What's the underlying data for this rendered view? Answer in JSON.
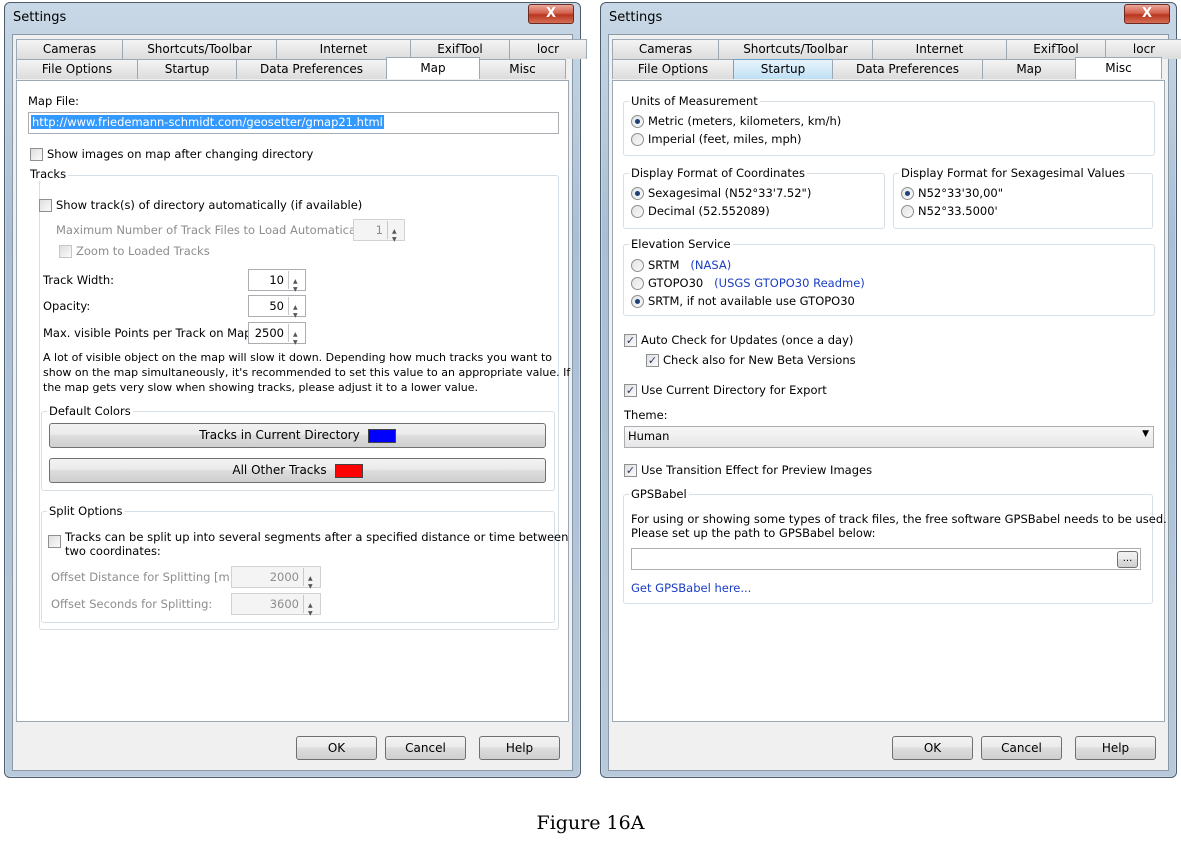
{
  "windows": [
    {
      "title": "Settings",
      "close": "X",
      "tabs_top": [
        "Cameras",
        "Shortcuts/Toolbar",
        "Internet",
        "ExifTool",
        "locr"
      ],
      "tabs_bottom": [
        "File Options",
        "Startup",
        "Data Preferences",
        "Map",
        "Misc"
      ],
      "map": {
        "map_file_label": "Map File:",
        "map_file_value": "http://www.friedemann-schmidt.com/geosetter/gmap21.html",
        "show_images": "Show images on map after changing directory",
        "tracks_group": "Tracks",
        "show_tracks": "Show track(s) of directory automatically (if available)",
        "max_files_label": "Maximum Number of Track Files to Load Automatically:",
        "max_files_value": "1",
        "zoom_loaded": "Zoom to Loaded Tracks",
        "track_width_label": "Track Width:",
        "track_width_value": "10",
        "opacity_label": "Opacity:",
        "opacity_value": "50",
        "max_points_label": "Max. visible Points per Track on Map:",
        "max_points_value": "2500",
        "note_1": "A lot of visible object on the map will slow it down. Depending how much tracks you want to",
        "note_2": "show on the map simultaneously, it's recommended to set this value to an appropriate value. If",
        "note_3": "the map gets very slow when showing tracks, please adjust it to a lower value.",
        "default_colors": "Default Colors",
        "btn_current": "Tracks in Current Directory",
        "btn_other": "All Other Tracks",
        "color_current": "#0000ff",
        "color_other": "#ff0000",
        "split_group": "Split Options",
        "split_1": "Tracks can be split up into several segments after a specified distance or time between",
        "split_2": "two coordinates:",
        "offset_dist_label": "Offset Distance for Splitting [m]:",
        "offset_dist_value": "2000",
        "offset_sec_label": "Offset Seconds for Splitting:",
        "offset_sec_value": "3600"
      },
      "buttons": {
        "ok": "OK",
        "cancel": "Cancel",
        "help": "Help"
      }
    },
    {
      "title": "Settings",
      "close": "X",
      "tabs_top": [
        "Cameras",
        "Shortcuts/Toolbar",
        "Internet",
        "ExifTool",
        "locr"
      ],
      "tabs_bottom": [
        "File Options",
        "Startup",
        "Data Preferences",
        "Map",
        "Misc"
      ],
      "misc": {
        "units_group": "Units of Measurement",
        "metric": "Metric (meters, kilometers, km/h)",
        "imperial": "Imperial (feet, miles, mph)",
        "coord_group": "Display Format of Coordinates",
        "sexagesimal": "Sexagesimal (N52°33'7.52\")",
        "decimal": "Decimal (52.552089)",
        "sexa_group": "Display Format for Sexagesimal Values",
        "sexa_1": "N52°33'30,00\"",
        "sexa_2": "N52°33.5000'",
        "elev_group": "Elevation Service",
        "srtm": "SRTM",
        "srtm_link": "(NASA)",
        "gtopo": "GTOPO30",
        "gtopo_link": "(USGS GTOPO30 Readme)",
        "srtm_gtopo": "SRTM, if not available use GTOPO30",
        "auto_check": "Auto Check for Updates (once a day)",
        "beta_check": "Check also for New Beta Versions",
        "use_current_dir": "Use Current Directory for Export",
        "theme_label": "Theme:",
        "theme_value": "Human",
        "transition": "Use Transition Effect for Preview Images",
        "gpsbabel_group": "GPSBabel",
        "gpsbabel_1": "For using or showing some types of track files, the free software GPSBabel needs to be used.",
        "gpsbabel_2": "Please set up the path to GPSBabel below:",
        "gpsbabel_path": "",
        "browse": "...",
        "get_gpsbabel": "Get GPSBabel here..."
      },
      "buttons": {
        "ok": "OK",
        "cancel": "Cancel",
        "help": "Help"
      }
    }
  ],
  "caption": "Figure 16A"
}
